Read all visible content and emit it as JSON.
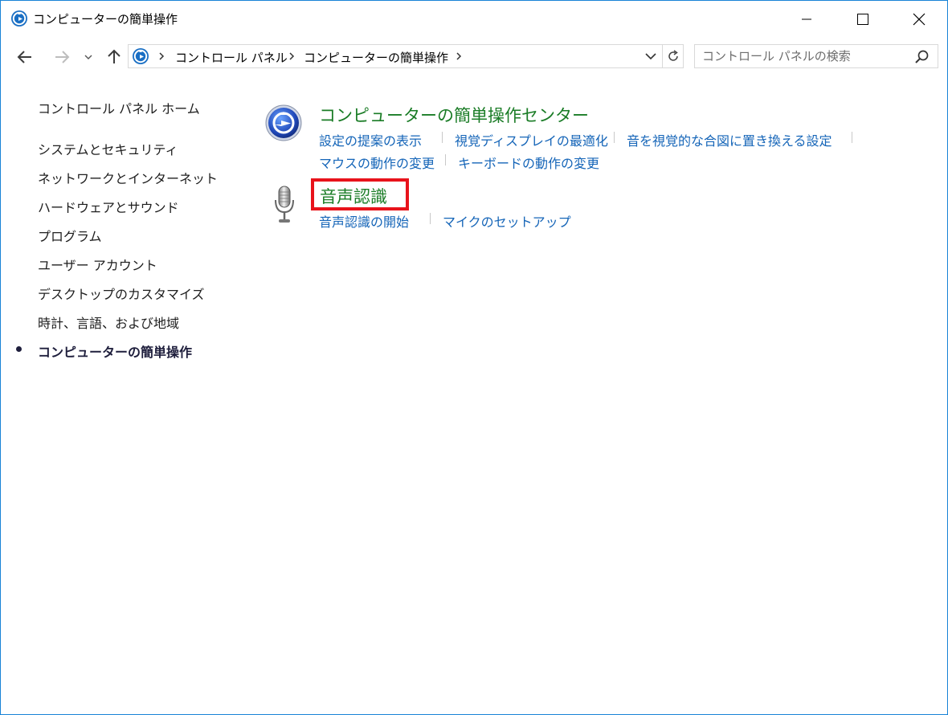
{
  "window": {
    "title": "コンピューターの簡単操作"
  },
  "address": {
    "crumbs": [
      "コントロール パネル",
      "コンピューターの簡単操作"
    ],
    "search_placeholder": "コントロール パネルの検索"
  },
  "sidebar": {
    "home": "コントロール パネル ホーム",
    "items": [
      "システムとセキュリティ",
      "ネットワークとインターネット",
      "ハードウェアとサウンド",
      "プログラム",
      "ユーザー アカウント",
      "デスクトップのカスタマイズ",
      "時計、言語、および地域",
      "コンピューターの簡単操作"
    ],
    "current_index": 7
  },
  "categories": [
    {
      "title": "コンピューターの簡単操作センター",
      "icon": "ease-of-access-icon",
      "links": [
        "設定の提案の表示",
        "視覚ディスプレイの最適化",
        "音を視覚的な合図に置き換える設定",
        "マウスの動作の変更",
        "キーボードの動作の変更"
      ]
    },
    {
      "title": "音声認識",
      "icon": "microphone-icon",
      "links": [
        "音声認識の開始",
        "マイクのセットアップ"
      ]
    }
  ],
  "colors": {
    "category_title": "#1a7c26",
    "link": "#1565b8",
    "highlight": "#e8131b",
    "window_border": "#1883d7"
  }
}
